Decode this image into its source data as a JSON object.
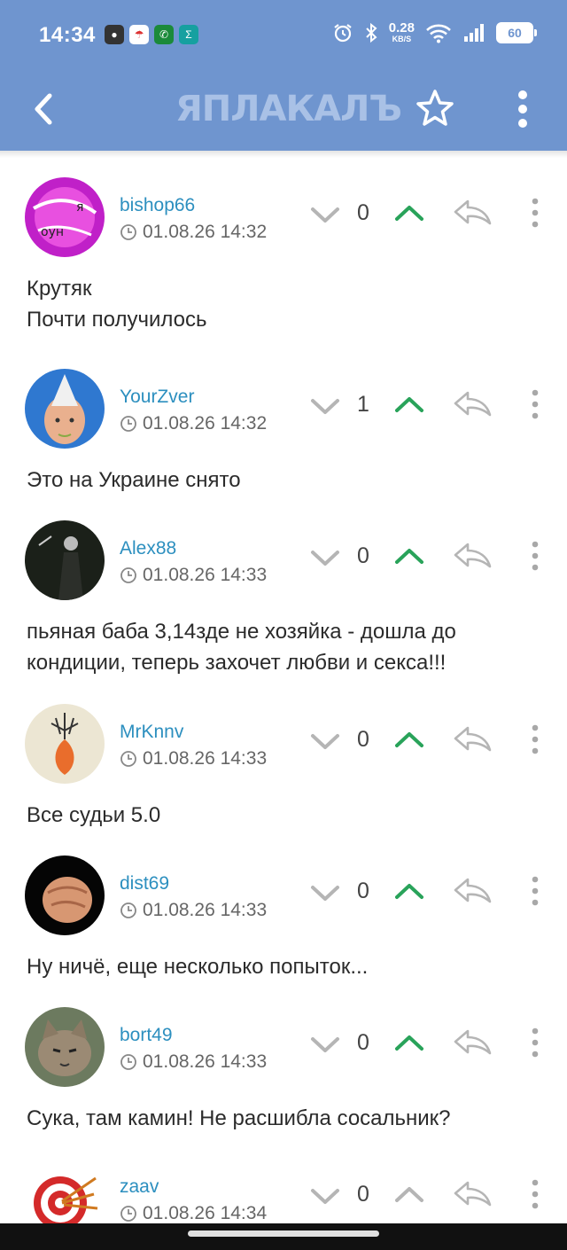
{
  "status_bar": {
    "time": "14:34",
    "net_speed_value": "0.28",
    "net_speed_unit": "KB/S",
    "battery": "60"
  },
  "toolbar": {
    "logo_text": "ЯПЛАКАЛЪ"
  },
  "colors": {
    "header_bg": "#6f95cf",
    "username": "#2c8fbf",
    "upvote_active": "#29a35a",
    "icon_gray": "#b5b5b5"
  },
  "comments": [
    {
      "username": "bishop66",
      "date": "01.08.26 14:32",
      "score": "0",
      "text_lines": [
        "Крутяк",
        "Почти получилось"
      ],
      "upvote_active": true
    },
    {
      "username": "YourZver",
      "date": "01.08.26 14:32",
      "score": "1",
      "text_lines": [
        "Это на Украине снято"
      ],
      "upvote_active": true
    },
    {
      "username": "Alex88",
      "date": "01.08.26 14:33",
      "score": "0",
      "text_lines": [
        "пьяная баба 3,14зде не хозяйка - дошла до",
        "кондиции, теперь захочет любви и секса!!!"
      ],
      "upvote_active": true
    },
    {
      "username": "MrKnnv",
      "date": "01.08.26 14:33",
      "score": "0",
      "text_lines": [
        "Все судьи 5.0"
      ],
      "upvote_active": true
    },
    {
      "username": "dist69",
      "date": "01.08.26 14:33",
      "score": "0",
      "text_lines": [
        "Ну ничё, еще несколько попыток..."
      ],
      "upvote_active": true
    },
    {
      "username": "bort49",
      "date": "01.08.26 14:33",
      "score": "0",
      "text_lines": [
        "Сука, там камин! Не расшибла сосальник?"
      ],
      "upvote_active": true
    },
    {
      "username": "zaav",
      "date": "01.08.26 14:34",
      "score": "0",
      "text_lines": [],
      "upvote_active": false
    }
  ]
}
